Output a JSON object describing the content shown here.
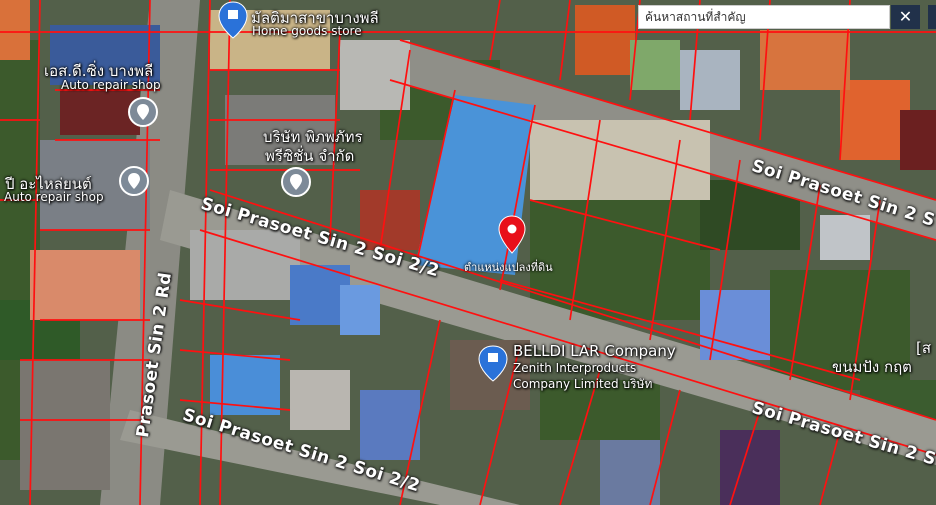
{
  "search": {
    "value": "ค้นหาสถานที่สำคัญ",
    "close_label": "✕"
  },
  "map": {
    "parcel_line_color": "#ff1010",
    "pin_color": "#e8101a",
    "pin_label": "ตำแหน่งแปลงที่ดิน",
    "roads": {
      "soi_2_2_upper": "Soi Prasoet Sin 2 Soi 2/2",
      "soi_2_2_lower": "Soi Prasoet Sin 2 Soi 2/2",
      "soi_right_top": "Soi Prasoet Sin 2 S",
      "soi_right_bottom": "Soi Prasoet Sin 2 S",
      "main_rd": "Prasoet Sin 2 Rd"
    },
    "places": {
      "home_goods_name": "มัลติมาสาขาบางพลี",
      "home_goods_type": "Home goods store",
      "auto1_name": "เอส.ดี.ซิ่ง บางพลี",
      "auto1_type": "Auto repair shop",
      "company1_line1": "บริษัท พิภพภัทร",
      "company1_line2": "พรีซิชั่น จำกัด",
      "auto2_name": "ปี อะไหล่ยนต์",
      "auto2_type": "Auto repair shop",
      "belldi_name": "BELLDI LAR Company",
      "zenith_line1": "Zenith Interproducts",
      "zenith_line2": "Company Limited บริษัท",
      "bakery_name": "ขนมปัง กฤต",
      "edge_char": "[ส"
    }
  }
}
